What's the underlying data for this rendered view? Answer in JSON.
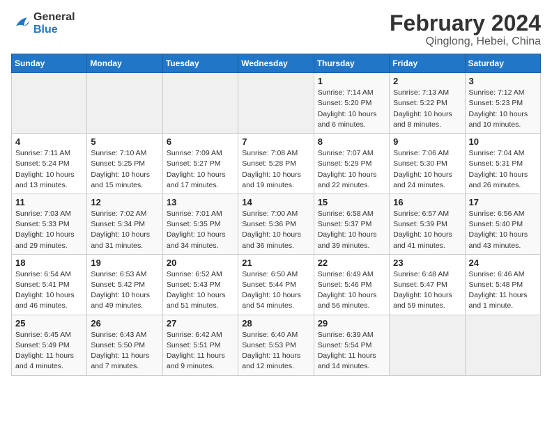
{
  "header": {
    "logo_line1": "General",
    "logo_line2": "Blue",
    "title": "February 2024",
    "subtitle": "Qinglong, Hebei, China"
  },
  "weekdays": [
    "Sunday",
    "Monday",
    "Tuesday",
    "Wednesday",
    "Thursday",
    "Friday",
    "Saturday"
  ],
  "weeks": [
    [
      {
        "day": "",
        "info": ""
      },
      {
        "day": "",
        "info": ""
      },
      {
        "day": "",
        "info": ""
      },
      {
        "day": "",
        "info": ""
      },
      {
        "day": "1",
        "info": "Sunrise: 7:14 AM\nSunset: 5:20 PM\nDaylight: 10 hours\nand 6 minutes."
      },
      {
        "day": "2",
        "info": "Sunrise: 7:13 AM\nSunset: 5:22 PM\nDaylight: 10 hours\nand 8 minutes."
      },
      {
        "day": "3",
        "info": "Sunrise: 7:12 AM\nSunset: 5:23 PM\nDaylight: 10 hours\nand 10 minutes."
      }
    ],
    [
      {
        "day": "4",
        "info": "Sunrise: 7:11 AM\nSunset: 5:24 PM\nDaylight: 10 hours\nand 13 minutes."
      },
      {
        "day": "5",
        "info": "Sunrise: 7:10 AM\nSunset: 5:25 PM\nDaylight: 10 hours\nand 15 minutes."
      },
      {
        "day": "6",
        "info": "Sunrise: 7:09 AM\nSunset: 5:27 PM\nDaylight: 10 hours\nand 17 minutes."
      },
      {
        "day": "7",
        "info": "Sunrise: 7:08 AM\nSunset: 5:28 PM\nDaylight: 10 hours\nand 19 minutes."
      },
      {
        "day": "8",
        "info": "Sunrise: 7:07 AM\nSunset: 5:29 PM\nDaylight: 10 hours\nand 22 minutes."
      },
      {
        "day": "9",
        "info": "Sunrise: 7:06 AM\nSunset: 5:30 PM\nDaylight: 10 hours\nand 24 minutes."
      },
      {
        "day": "10",
        "info": "Sunrise: 7:04 AM\nSunset: 5:31 PM\nDaylight: 10 hours\nand 26 minutes."
      }
    ],
    [
      {
        "day": "11",
        "info": "Sunrise: 7:03 AM\nSunset: 5:33 PM\nDaylight: 10 hours\nand 29 minutes."
      },
      {
        "day": "12",
        "info": "Sunrise: 7:02 AM\nSunset: 5:34 PM\nDaylight: 10 hours\nand 31 minutes."
      },
      {
        "day": "13",
        "info": "Sunrise: 7:01 AM\nSunset: 5:35 PM\nDaylight: 10 hours\nand 34 minutes."
      },
      {
        "day": "14",
        "info": "Sunrise: 7:00 AM\nSunset: 5:36 PM\nDaylight: 10 hours\nand 36 minutes."
      },
      {
        "day": "15",
        "info": "Sunrise: 6:58 AM\nSunset: 5:37 PM\nDaylight: 10 hours\nand 39 minutes."
      },
      {
        "day": "16",
        "info": "Sunrise: 6:57 AM\nSunset: 5:39 PM\nDaylight: 10 hours\nand 41 minutes."
      },
      {
        "day": "17",
        "info": "Sunrise: 6:56 AM\nSunset: 5:40 PM\nDaylight: 10 hours\nand 43 minutes."
      }
    ],
    [
      {
        "day": "18",
        "info": "Sunrise: 6:54 AM\nSunset: 5:41 PM\nDaylight: 10 hours\nand 46 minutes."
      },
      {
        "day": "19",
        "info": "Sunrise: 6:53 AM\nSunset: 5:42 PM\nDaylight: 10 hours\nand 49 minutes."
      },
      {
        "day": "20",
        "info": "Sunrise: 6:52 AM\nSunset: 5:43 PM\nDaylight: 10 hours\nand 51 minutes."
      },
      {
        "day": "21",
        "info": "Sunrise: 6:50 AM\nSunset: 5:44 PM\nDaylight: 10 hours\nand 54 minutes."
      },
      {
        "day": "22",
        "info": "Sunrise: 6:49 AM\nSunset: 5:46 PM\nDaylight: 10 hours\nand 56 minutes."
      },
      {
        "day": "23",
        "info": "Sunrise: 6:48 AM\nSunset: 5:47 PM\nDaylight: 10 hours\nand 59 minutes."
      },
      {
        "day": "24",
        "info": "Sunrise: 6:46 AM\nSunset: 5:48 PM\nDaylight: 11 hours\nand 1 minute."
      }
    ],
    [
      {
        "day": "25",
        "info": "Sunrise: 6:45 AM\nSunset: 5:49 PM\nDaylight: 11 hours\nand 4 minutes."
      },
      {
        "day": "26",
        "info": "Sunrise: 6:43 AM\nSunset: 5:50 PM\nDaylight: 11 hours\nand 7 minutes."
      },
      {
        "day": "27",
        "info": "Sunrise: 6:42 AM\nSunset: 5:51 PM\nDaylight: 11 hours\nand 9 minutes."
      },
      {
        "day": "28",
        "info": "Sunrise: 6:40 AM\nSunset: 5:53 PM\nDaylight: 11 hours\nand 12 minutes."
      },
      {
        "day": "29",
        "info": "Sunrise: 6:39 AM\nSunset: 5:54 PM\nDaylight: 11 hours\nand 14 minutes."
      },
      {
        "day": "",
        "info": ""
      },
      {
        "day": "",
        "info": ""
      }
    ]
  ]
}
